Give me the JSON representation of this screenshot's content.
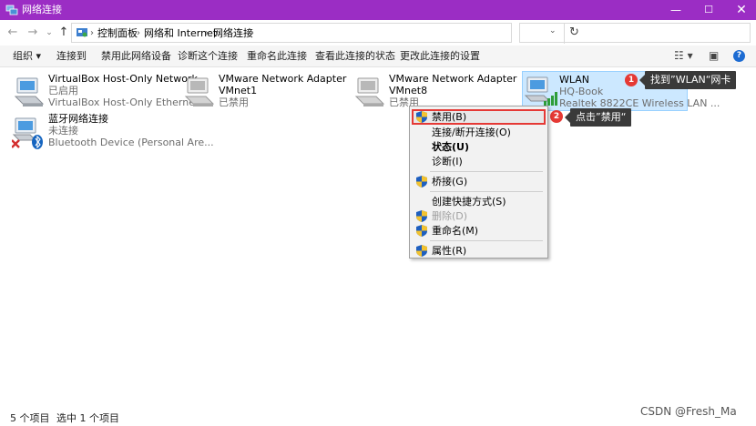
{
  "window": {
    "title": "网络连接",
    "minimize": "—",
    "maximize": "☐",
    "close": "✕"
  },
  "nav": {
    "back": "←",
    "forward": "→",
    "recent": "⌄",
    "up": "↑",
    "refresh": "↻",
    "dropdown": "⌄"
  },
  "breadcrumb": [
    "控制面板",
    "网络和 Internet",
    "网络连接"
  ],
  "breadcrumb_sep": "›",
  "search": {
    "placeholder": ""
  },
  "toolbar": {
    "items": [
      "组织 ▾",
      "连接到",
      "禁用此网络设备",
      "诊断这个连接",
      "重命名此连接",
      "查看此连接的状态",
      "更改此连接的设置"
    ],
    "view_options": "☷ ▾",
    "preview_pane": "▣",
    "help": "?"
  },
  "connections": [
    {
      "name": "VirtualBox Host-Only Network",
      "status": "已启用",
      "device": "VirtualBox Host-Only Ethernet ...",
      "selected": false
    },
    {
      "name": "VMware Network Adapter",
      "name2": "VMnet1",
      "status": "已禁用",
      "device": "",
      "selected": false
    },
    {
      "name": "VMware Network Adapter",
      "name2": "VMnet8",
      "status": "已禁用",
      "device": "",
      "selected": false
    },
    {
      "name": "WLAN",
      "status": "HQ-Book",
      "device": "Realtek 8822CE Wireless LAN ...",
      "selected": true
    },
    {
      "name": "蓝牙网络连接",
      "status": "未连接",
      "device": "Bluetooth Device (Personal Are...",
      "selected": false
    }
  ],
  "context_menu": {
    "items": [
      {
        "label": "禁用(B)",
        "shield": true,
        "bold": false,
        "disabled": false,
        "highlighted": true
      },
      {
        "label": "连接/断开连接(O)",
        "shield": false,
        "bold": false,
        "disabled": false,
        "highlighted": false
      },
      {
        "label": "状态(U)",
        "shield": false,
        "bold": true,
        "disabled": false,
        "highlighted": false
      },
      {
        "label": "诊断(I)",
        "shield": false,
        "bold": false,
        "disabled": false,
        "highlighted": false
      },
      {
        "label": "桥接(G)",
        "shield": true,
        "bold": false,
        "disabled": false,
        "highlighted": false
      },
      {
        "label": "创建快捷方式(S)",
        "shield": false,
        "bold": false,
        "disabled": false,
        "highlighted": false
      },
      {
        "label": "删除(D)",
        "shield": true,
        "bold": false,
        "disabled": true,
        "highlighted": false
      },
      {
        "label": "重命名(M)",
        "shield": true,
        "bold": false,
        "disabled": false,
        "highlighted": false
      },
      {
        "label": "属性(R)",
        "shield": true,
        "bold": false,
        "disabled": false,
        "highlighted": false
      }
    ]
  },
  "callouts": [
    {
      "step": "1",
      "text": "找到”WLAN“网卡"
    },
    {
      "step": "2",
      "text": "点击”禁用“"
    }
  ],
  "statusbar": {
    "count": "5 个项目",
    "selected": "选中 1 个项目"
  },
  "watermark": "CSDN @Fresh_Ma",
  "colors": {
    "titlebar": "#9b2dc4",
    "selection": "#cce8ff",
    "highlight_border": "#e53935",
    "callout_bg": "#3a3a3a"
  },
  "icons": [
    "network-adapter-icon",
    "wifi-signal-icon",
    "bluetooth-icon",
    "disconnected-x-icon",
    "uac-shield-icon",
    "control-panel-icon"
  ]
}
